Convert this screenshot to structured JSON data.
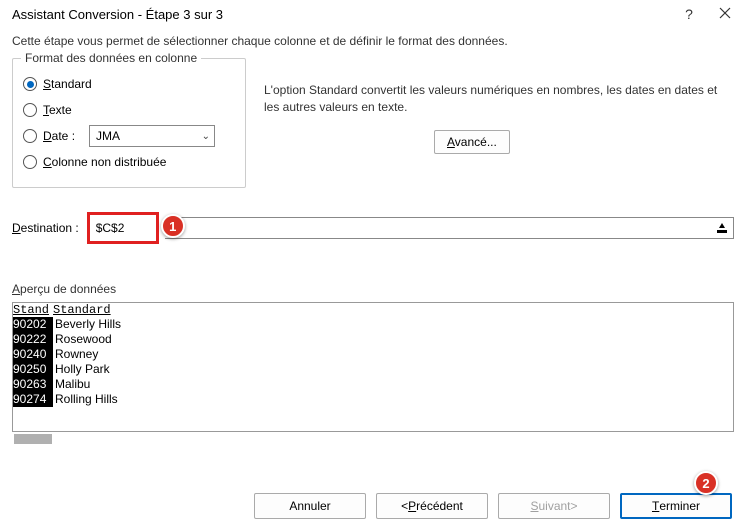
{
  "titlebar": {
    "title": "Assistant Conversion - Étape 3 sur 3"
  },
  "intro": "Cette étape vous permet de sélectionner chaque colonne et de définir le format des données.",
  "format_group": {
    "title": "Format des données en colonne",
    "standard": "Standard",
    "texte": "Texte",
    "date": "Date :",
    "date_value": "JMA",
    "skip": "Colonne non distribuée"
  },
  "right": {
    "desc": "L'option Standard convertit les valeurs numériques en nombres, les dates en dates et les autres valeurs en texte.",
    "advanced": "Avancé..."
  },
  "destination": {
    "label": "Destination :",
    "value": "$C$2"
  },
  "callouts": {
    "one": "1",
    "two": "2"
  },
  "preview": {
    "title": "Aperçu de données",
    "header1": "Stand",
    "header2": "Standard",
    "rows": [
      {
        "zip": "90202",
        "city": "Beverly Hills"
      },
      {
        "zip": "90222",
        "city": "Rosewood"
      },
      {
        "zip": "90240",
        "city": "Rowney"
      },
      {
        "zip": "90250",
        "city": "Holly Park"
      },
      {
        "zip": "90263",
        "city": "Malibu"
      },
      {
        "zip": "90274",
        "city": "Rolling Hills"
      }
    ]
  },
  "buttons": {
    "cancel": "Annuler",
    "back": "< Précédent",
    "next": "Suivant >",
    "finish": "Terminer"
  }
}
